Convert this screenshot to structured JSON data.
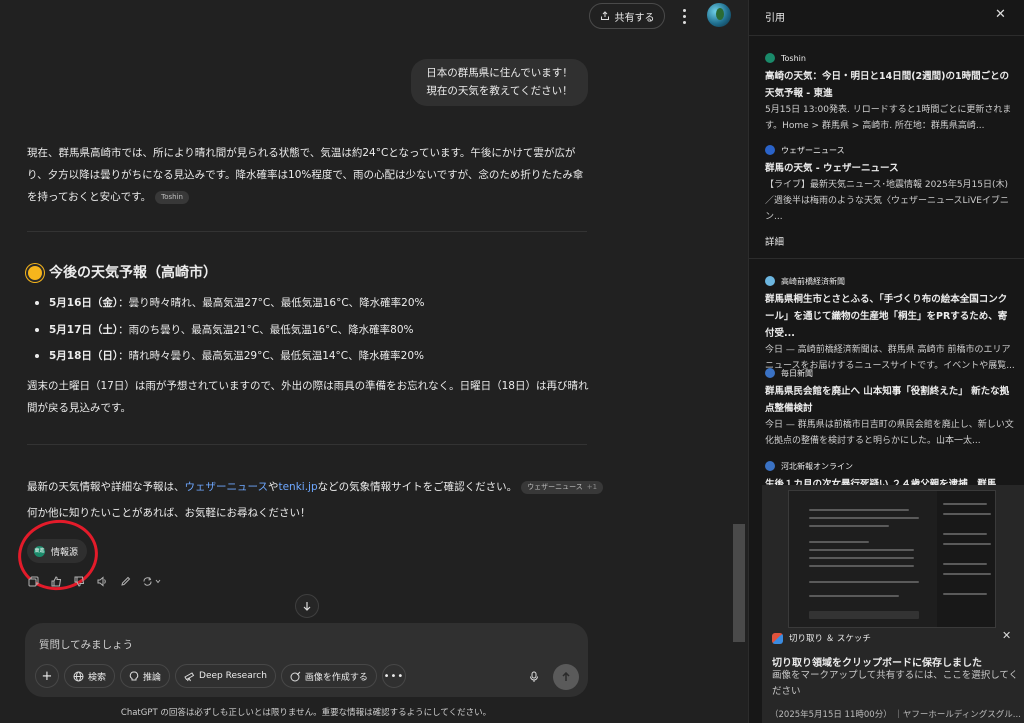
{
  "topbar": {
    "share_label": "共有する"
  },
  "chat": {
    "user_message_line1": "日本の群馬県に住んでいます！",
    "user_message_line2": "現在の天気を教えてください！",
    "para1": "現在、群馬県高崎市では、所により晴れ間が見られる状態で、気温は約24°Cとなっています。午後にかけて雲が広がり、夕方以降は曇りがちになる見込みです。降水確率は10%程度で、雨の心配は少ないですが、念のため折りたたみ傘を持っておくと安心です。",
    "para1_chip": "Toshin",
    "heading": "今後の天気予報（高崎市）",
    "forecast": [
      {
        "date": "5月16日（金）",
        "desc": "：曇り時々晴れ、最高気温27°C、最低気温16°C、降水確率20%"
      },
      {
        "date": "5月17日（土）",
        "desc": "：雨のち曇り、最高気温21°C、最低気温16°C、降水確率80%"
      },
      {
        "date": "5月18日（日）",
        "desc": "：晴れ時々曇り、最高気温29°C、最低気温14°C、降水確率20%"
      }
    ],
    "para2": "週末の土曜日（17日）は雨が予想されていますので、外出の際は雨具の準備をお忘れなく。日曜日（18日）は再び晴れ間が戻る見込みです。",
    "para3_prefix": "最新の天気情報や詳細な予報は、",
    "para3_link1": "ウェザーニュース",
    "para3_mid": "や",
    "para3_link2": "tenki.jp",
    "para3_suffix": "などの気象情報サイトをご確認ください。",
    "para3_chip": "ウェザーニュース",
    "para3_chip_more": "+1",
    "para4": "何か他に知りたいことがあれば、お気軽にお尋ねください！",
    "sources_label": "情報源",
    "sources_favicon": "東進"
  },
  "composer": {
    "placeholder": "質問してみましょう",
    "tools": {
      "search": "検索",
      "reason": "推論",
      "deep_research": "Deep Research",
      "create_image": "画像を作成する"
    }
  },
  "disclaimer": "ChatGPT の回答は必ずしも正しいとは限りません。重要な情報は確認するようにしてください。",
  "panel": {
    "title": "引用",
    "section_details": "詳細",
    "citations": [
      {
        "source": "Toshin",
        "favicon_color": "#1a8a6a",
        "title": "高崎の天気：今日・明日と14日間(2週間)の1時間ごとの天気予報 - 東進",
        "snippet": "5月15日 13:00発表. リロードすると1時間ごとに更新されます。Home > 群馬県 > 高崎市. 所在地：群馬県高崎..."
      },
      {
        "source": "ウェザーニュース",
        "favicon_color": "#2a63c9",
        "title": "群馬の天気 - ウェザーニュース",
        "snippet": "【ライブ】最新天気ニュース･地震情報 2025年5月15日(木)\n／週後半は梅雨のような天気〈ウェザーニュースLiVEイブニン..."
      }
    ],
    "details": [
      {
        "source": "高崎前橋経済新聞",
        "favicon_color": "#6cb6e0",
        "title": "群馬県桐生市とさとふる、「手づくり布の絵本全国コンクール」を通じて織物の生産地「桐生」をPRするため、寄付受...",
        "snippet": "今日 — 高崎前橋経済新聞は、群馬県 高崎市 前橋市のエリアニュースをお届けするニュースサイトです。イベントや展覧..."
      },
      {
        "source": "毎日新聞",
        "favicon_color": "#3a72c4",
        "title": "群馬県民会館を廃止へ 山本知事「役割終えた」 新たな拠点整備検討",
        "snippet": "今日 — 群馬県は前橋市日吉町の県民会館を廃止し、新しい文化拠点の整備を検討すると明らかにした。山本一太..."
      },
      {
        "source": "河北新報オンライン",
        "favicon_color": "#3a72c4",
        "title": "生後１カ月の次女暴行死疑い ２４歳父親を逮捕　群馬",
        "snippet": ""
      }
    ]
  },
  "toast": {
    "app_name": "切り取り ＆ スケッチ",
    "title": "切り取り領域をクリップボードに保存しました",
    "body": "画像をマークアップして共有するには、ここを選択してください"
  },
  "peek_text": "（2025年5月15日 11時00分） ｜ヤフーホールディングスグル..."
}
